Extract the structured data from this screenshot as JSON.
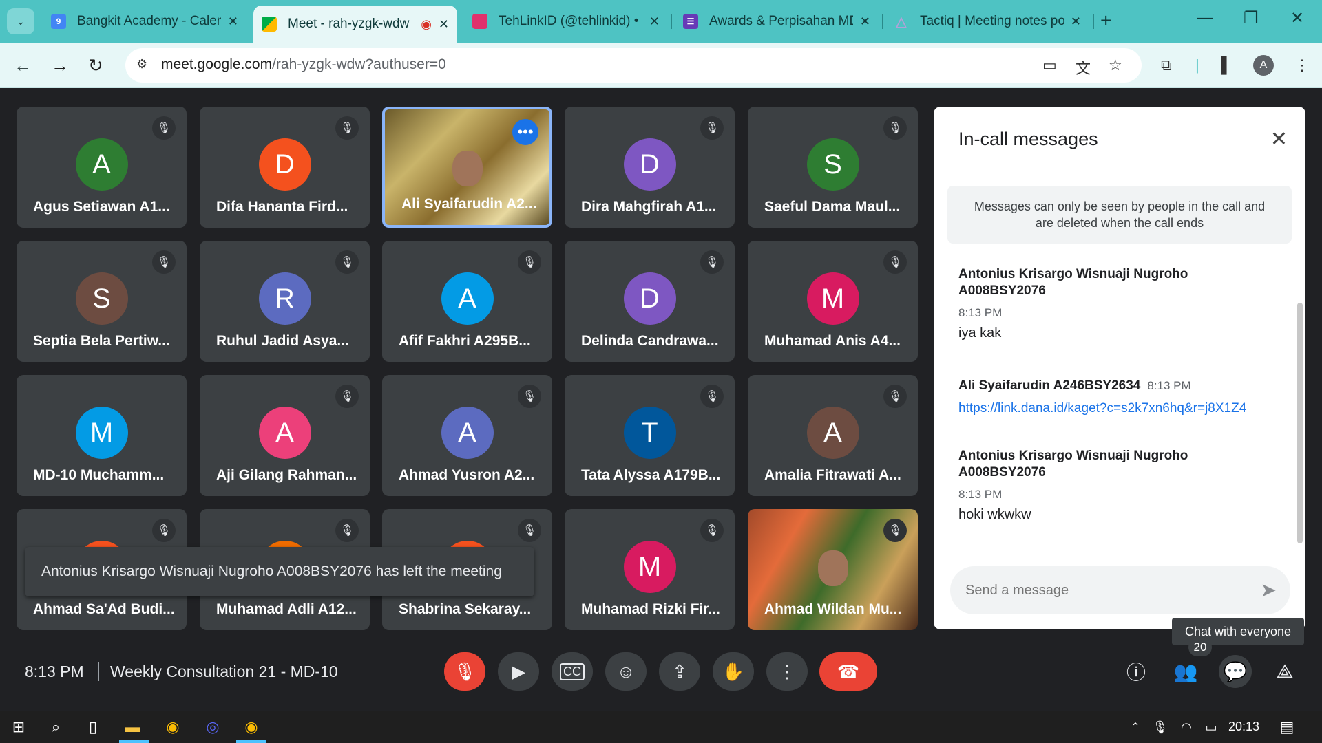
{
  "browser": {
    "tabs": [
      {
        "title": "Bangkit Academy - Calen",
        "favicon_color": "#4285f4",
        "favicon_glyph": "9"
      },
      {
        "title": "Meet - rah-yzgk-wdw",
        "favicon_color": "#00ac47",
        "favicon_glyph": "",
        "recording": true
      },
      {
        "title": "TehLinkID (@tehlinkid) •",
        "favicon_color": "#e1306c",
        "favicon_glyph": ""
      },
      {
        "title": "Awards & Perpisahan MD",
        "favicon_color": "#673ab7",
        "favicon_glyph": "☰"
      },
      {
        "title": "Tactiq | Meeting notes po",
        "favicon_color": "#b0a2d8",
        "favicon_glyph": "△"
      }
    ],
    "url_host": "meet.google.com",
    "url_path": "/rah-yzgk-wdw?authuser=0",
    "profile_initial": "A"
  },
  "participants": [
    {
      "initial": "A",
      "name": "Agus Setiawan A1...",
      "color": "#2e7d32",
      "muted": true
    },
    {
      "initial": "D",
      "name": "Difa Hananta Fird...",
      "color": "#f4511e",
      "muted": true
    },
    {
      "initial": "",
      "name": "Ali Syaifarudin A2...",
      "color": "",
      "muted": false,
      "video": true,
      "speaking": true
    },
    {
      "initial": "D",
      "name": "Dira Mahgfirah A1...",
      "color": "#7e57c2",
      "muted": true
    },
    {
      "initial": "S",
      "name": "Saeful Dama Maul...",
      "color": "#2e7d32",
      "muted": true
    },
    {
      "initial": "S",
      "name": "Septia Bela Pertiw...",
      "color": "#6d4c41",
      "muted": true
    },
    {
      "initial": "R",
      "name": "Ruhul Jadid Asya...",
      "color": "#5c6bc0",
      "muted": true
    },
    {
      "initial": "A",
      "name": "Afif Fakhri A295B...",
      "color": "#039be5",
      "muted": true
    },
    {
      "initial": "D",
      "name": "Delinda Candrawa...",
      "color": "#7e57c2",
      "muted": true
    },
    {
      "initial": "M",
      "name": "Muhamad Anis A4...",
      "color": "#d81b60",
      "muted": true
    },
    {
      "initial": "M",
      "name": "MD-10 Muchamm...",
      "color": "#039be5",
      "muted": false
    },
    {
      "initial": "A",
      "name": "Aji Gilang Rahman...",
      "color": "#ec407a",
      "muted": true
    },
    {
      "initial": "A",
      "name": "Ahmad Yusron A2...",
      "color": "#5c6bc0",
      "muted": true
    },
    {
      "initial": "T",
      "name": "Tata Alyssa A179B...",
      "color": "#01579b",
      "muted": true
    },
    {
      "initial": "A",
      "name": "Amalia Fitrawati A...",
      "color": "#6d4c41",
      "muted": true
    },
    {
      "initial": "",
      "name": "Ahmad Sa'Ad Budi...",
      "color": "#f4511e",
      "muted": true
    },
    {
      "initial": "",
      "name": "Muhamad Adli A12...",
      "color": "#ef6c00",
      "muted": true
    },
    {
      "initial": "",
      "name": "Shabrina Sekaray...",
      "color": "#f4511e",
      "muted": true
    },
    {
      "initial": "M",
      "name": "Muhamad Rizki Fir...",
      "color": "#d81b60",
      "muted": true
    },
    {
      "initial": "",
      "name": "Ahmad Wildan Mu...",
      "color": "",
      "muted": true,
      "video": true
    }
  ],
  "toast": "Antonius Krisargo Wisnuaji Nugroho A008BSY2076 has left the meeting",
  "chat": {
    "title": "In-call messages",
    "info": "Messages can only be seen by people in the call and are deleted when the call ends",
    "messages": [
      {
        "sender": "Antonius Krisargo Wisnuaji Nugroho A008BSY2076",
        "time": "8:13 PM",
        "text": "iya kak"
      },
      {
        "sender": "Ali Syaifarudin A246BSY2634",
        "time": "8:13 PM",
        "link": "https://link.dana.id/kaget?c=s2k7xn6hq&r=j8X1Z4"
      },
      {
        "sender": "Antonius Krisargo Wisnuaji Nugroho A008BSY2076",
        "time": "8:13 PM",
        "text": "hoki wkwkw"
      }
    ],
    "placeholder": "Send a message",
    "tooltip": "Chat with everyone"
  },
  "bottom": {
    "time": "8:13 PM",
    "meeting_name": "Weekly Consultation 21 - MD-10",
    "participant_count": "20"
  },
  "taskbar": {
    "clock": "20:13"
  }
}
